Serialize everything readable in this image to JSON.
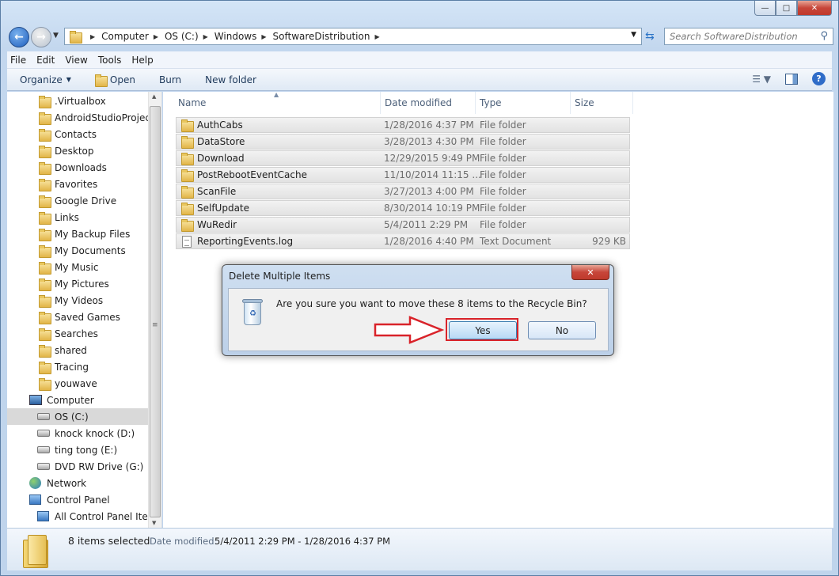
{
  "address": {
    "crumbs": [
      "Computer",
      "OS (C:)",
      "Windows",
      "SoftwareDistribution"
    ],
    "search_placeholder": "Search SoftwareDistribution"
  },
  "menu": [
    "File",
    "Edit",
    "View",
    "Tools",
    "Help"
  ],
  "toolbar": {
    "organize": "Organize",
    "open": "Open",
    "burn": "Burn",
    "new_folder": "New folder"
  },
  "nav": {
    "items": [
      {
        "label": ".Virtualbox",
        "icon": "folder-icon"
      },
      {
        "label": "AndroidStudioProjects",
        "icon": "folder-icon"
      },
      {
        "label": "Contacts",
        "icon": "folder-icon"
      },
      {
        "label": "Desktop",
        "icon": "folder-icon"
      },
      {
        "label": "Downloads",
        "icon": "folder-icon"
      },
      {
        "label": "Favorites",
        "icon": "folder-icon"
      },
      {
        "label": "Google Drive",
        "icon": "folder-icon"
      },
      {
        "label": "Links",
        "icon": "folder-icon"
      },
      {
        "label": "My Backup Files",
        "icon": "folder-icon"
      },
      {
        "label": "My Documents",
        "icon": "folder-icon"
      },
      {
        "label": "My Music",
        "icon": "folder-icon"
      },
      {
        "label": "My Pictures",
        "icon": "folder-icon"
      },
      {
        "label": "My Videos",
        "icon": "folder-icon"
      },
      {
        "label": "Saved Games",
        "icon": "folder-icon"
      },
      {
        "label": "Searches",
        "icon": "folder-icon"
      },
      {
        "label": "shared",
        "icon": "folder-icon"
      },
      {
        "label": "Tracing",
        "icon": "folder-icon"
      },
      {
        "label": "youwave",
        "icon": "folder-icon"
      },
      {
        "label": "Computer",
        "icon": "computer-icon"
      },
      {
        "label": "OS (C:)",
        "icon": "drive-icon"
      },
      {
        "label": "knock knock (D:)",
        "icon": "drive-icon"
      },
      {
        "label": "ting tong (E:)",
        "icon": "drive-icon"
      },
      {
        "label": "DVD RW Drive (G:)",
        "icon": "dvd-drive-icon"
      },
      {
        "label": "Network",
        "icon": "network-icon"
      },
      {
        "label": "Control Panel",
        "icon": "control-panel-icon"
      },
      {
        "label": "All Control Panel Items",
        "icon": "control-panel-icon"
      }
    ]
  },
  "columns": {
    "name": "Name",
    "date": "Date modified",
    "type": "Type",
    "size": "Size"
  },
  "files": [
    {
      "name": "AuthCabs",
      "date": "1/28/2016 4:37 PM",
      "type": "File folder",
      "size": ""
    },
    {
      "name": "DataStore",
      "date": "3/28/2013 4:30 PM",
      "type": "File folder",
      "size": ""
    },
    {
      "name": "Download",
      "date": "12/29/2015 9:49 PM",
      "type": "File folder",
      "size": ""
    },
    {
      "name": "PostRebootEventCache",
      "date": "11/10/2014 11:15 ...",
      "type": "File folder",
      "size": ""
    },
    {
      "name": "ScanFile",
      "date": "3/27/2013 4:00 PM",
      "type": "File folder",
      "size": ""
    },
    {
      "name": "SelfUpdate",
      "date": "8/30/2014 10:19 PM",
      "type": "File folder",
      "size": ""
    },
    {
      "name": "WuRedir",
      "date": "5/4/2011 2:29 PM",
      "type": "File folder",
      "size": ""
    },
    {
      "name": "ReportingEvents.log",
      "date": "1/28/2016 4:40 PM",
      "type": "Text Document",
      "size": "929 KB"
    }
  ],
  "details": {
    "count": "8 items selected",
    "modified_label": "Date modified:",
    "modified_value": "5/4/2011 2:29 PM - 1/28/2016 4:37 PM"
  },
  "dialog": {
    "title": "Delete Multiple Items",
    "message": "Are you sure you want to move these 8 items to the Recycle Bin?",
    "yes": "Yes",
    "no": "No"
  }
}
